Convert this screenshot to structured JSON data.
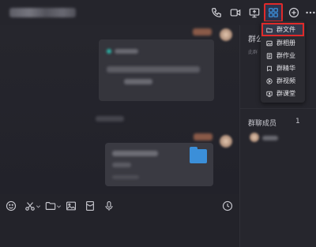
{
  "header": {
    "icons": [
      "phone-icon",
      "video-icon",
      "screen-share-icon",
      "apps-grid-icon",
      "add-icon",
      "more-icon"
    ]
  },
  "toolbar": {
    "icons": [
      "emoji-icon",
      "scissors-icon",
      "chevron-down-icon",
      "folder-icon",
      "chevron-down-icon",
      "image-icon",
      "red-packet-icon",
      "microphone-icon",
      "history-clock-icon"
    ]
  },
  "panel": {
    "announcement_title": "群公",
    "announcement_preview": "此群",
    "members_label": "群聊成员",
    "members_count": "1"
  },
  "dropdown": {
    "items": [
      {
        "label": "群文件",
        "icon": "folder-icon",
        "selected": true
      },
      {
        "label": "群相册",
        "icon": "album-icon",
        "selected": false
      },
      {
        "label": "群作业",
        "icon": "homework-icon",
        "selected": false
      },
      {
        "label": "群精华",
        "icon": "essence-icon",
        "selected": false
      },
      {
        "label": "群视频",
        "icon": "video-icon",
        "selected": false
      },
      {
        "label": "群课堂",
        "icon": "classroom-icon",
        "selected": false
      }
    ]
  },
  "colors": {
    "highlight_red": "#e02a2a",
    "accent_blue": "#3b8fd9",
    "background": "#23232a"
  }
}
